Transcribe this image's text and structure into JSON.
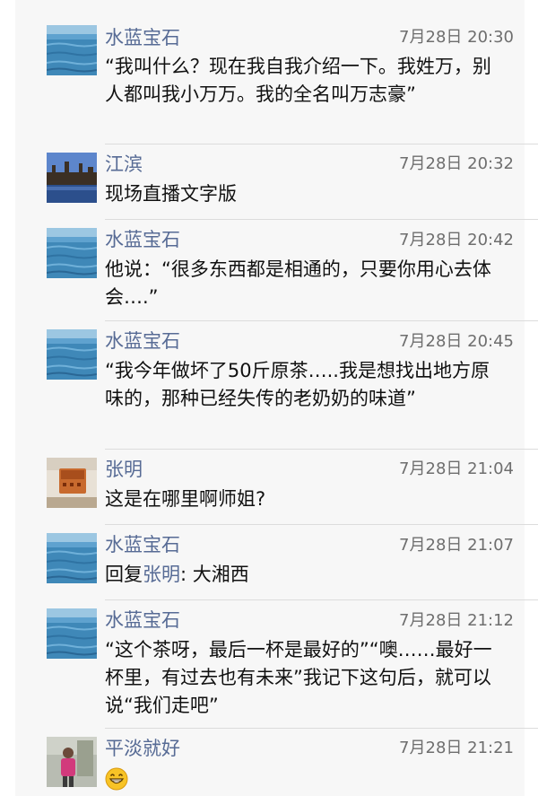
{
  "messages": [
    {
      "author": "水蓝宝石",
      "time": "7月28日 20:30",
      "text": "“我叫什么？现在我自我介绍一下。我姓万，别人都叫我小万万。我的全名叫万志豪”",
      "avatar": "ocean-avatar"
    },
    {
      "author": "江滨",
      "time": "7月28日 20:32",
      "text": "现场直播文字版",
      "avatar": "building-avatar"
    },
    {
      "author": "水蓝宝石",
      "time": "7月28日 20:42",
      "text": "他说：“很多东西都是相通的，只要你用心去体会….”",
      "avatar": "ocean-avatar"
    },
    {
      "author": "水蓝宝石",
      "time": "7月28日 20:45",
      "text": "“我今年做坏了50斤原茶…..我是想找出地方原味的，那种已经失传的老奶奶的味道”",
      "avatar": "ocean-avatar"
    },
    {
      "author": "张明",
      "time": "7月28日 21:04",
      "text": "这是在哪里啊师姐?",
      "avatar": "food-avatar"
    },
    {
      "author": "水蓝宝石",
      "time": "7月28日 21:07",
      "reply_prefix": "回复",
      "reply_to": "张明",
      "reply_text": ": 大湘西",
      "avatar": "ocean-avatar"
    },
    {
      "author": "水蓝宝石",
      "time": "7月28日 21:12",
      "text": "“这个茶呀，最后一杯是最好的”“噢……最好一杯里，有过去也有未来”我记下这句后，就可以说“我们走吧”",
      "avatar": "ocean-avatar"
    },
    {
      "author": "平淡就好",
      "time": "7月28日 21:21",
      "emoji": "grinning-face-emoji",
      "avatar": "person-avatar"
    }
  ],
  "colors": {
    "name": "#576b95",
    "text": "#111111",
    "time": "#6e6e6e",
    "panel": "#f7f7f7"
  }
}
